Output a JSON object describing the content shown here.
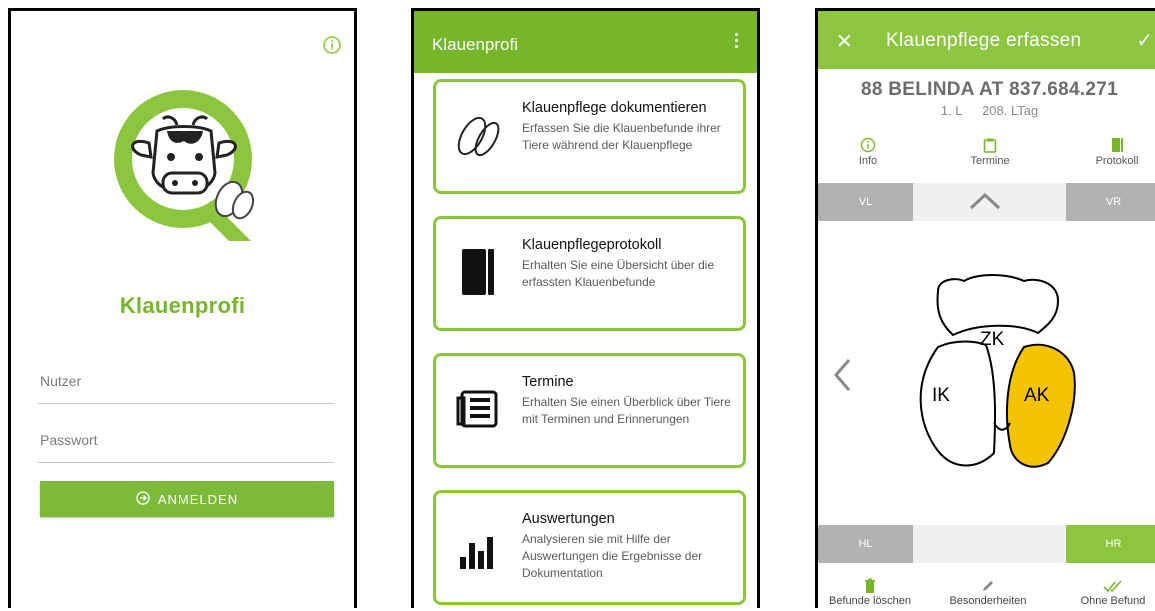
{
  "login": {
    "info_icon": "info-icon",
    "brand_name": "Klauenprofi",
    "user_placeholder": "Nutzer",
    "password_placeholder": "Passwort",
    "login_button": "ANMELDEN",
    "login_icon": "login-arrow-icon",
    "colors": {
      "brand": "#76b72a",
      "button": "#7cbb3a"
    }
  },
  "menu": {
    "app_title": "Klauenprofi",
    "menu_icon": "kebab-menu-icon",
    "cards": [
      {
        "title": "Klauenpflege dokumentieren",
        "description": "Erfassen Sie die Klauenbefunde ihrer Tiere während der Klauenpflege",
        "icon": "hoof-icon"
      },
      {
        "title": "Klauenpflegeprotokoll",
        "description": "Erhalten Sie eine Übersicht über die erfassten Klauenbefunde",
        "icon": "notebook-icon"
      },
      {
        "title": "Termine",
        "description": "Erhalten Sie einen Überblick über Tiere mit Terminen und Erinnerungen",
        "icon": "newspaper-icon"
      },
      {
        "title": "Auswertungen",
        "description": "Analysieren sie mit Hilfe der Auswertungen die Ergebnisse der Dokumentation",
        "icon": "bar-chart-icon"
      }
    ],
    "colors": {
      "appbar": "#76b72a",
      "card_border": "#8cc63f"
    }
  },
  "detail": {
    "close_icon": "close-icon",
    "title": "Klauenpflege erfassen",
    "confirm_icon": "check-icon",
    "animal_id": "88 BELINDA AT 837.684.271",
    "lactation": "1. L",
    "lactation_day": "208. LTag",
    "tabs": [
      {
        "label": "Info",
        "icon": "info-icon"
      },
      {
        "label": "Termine",
        "icon": "clipboard-icon"
      },
      {
        "label": "Protokoll",
        "icon": "notebook-icon"
      }
    ],
    "legs_top": {
      "left": "VL",
      "right": "VR"
    },
    "legs_bottom": {
      "left": "HL",
      "right": "HR"
    },
    "zones": {
      "top": "ZK",
      "inner": "IK",
      "outer": "AK"
    },
    "bottom_actions": [
      {
        "label": "Befunde löschen",
        "icon": "trash-icon"
      },
      {
        "label": "Besonderheiten",
        "icon": "pencil-icon"
      },
      {
        "label": "Ohne Befund",
        "icon": "double-check-icon"
      }
    ],
    "colors": {
      "appbar": "#8cc63f",
      "selected_zone": "#f5c400",
      "inactive_chip": "#b2b2b2"
    }
  }
}
